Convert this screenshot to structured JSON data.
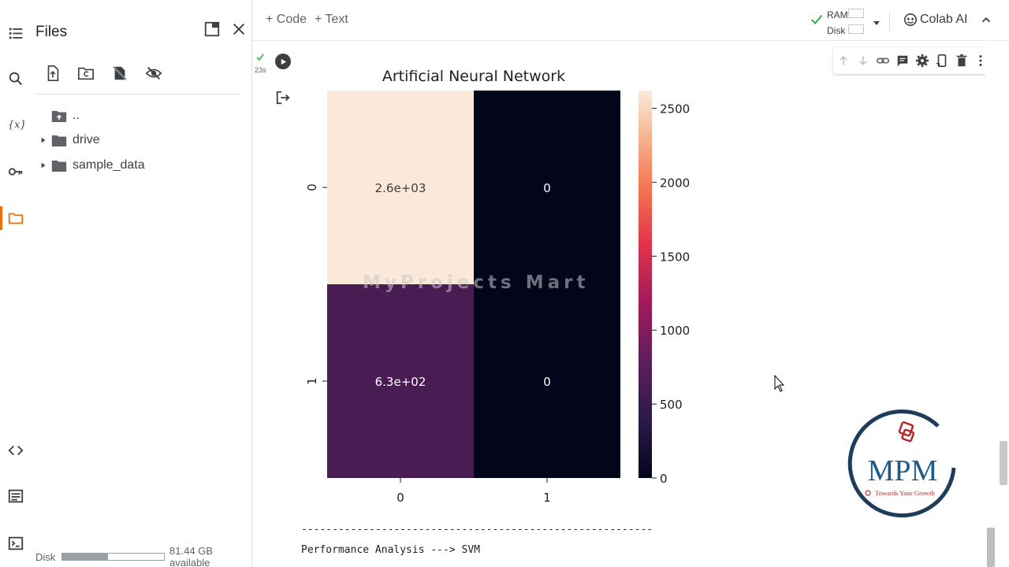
{
  "files_panel": {
    "title": "Files",
    "tree": [
      {
        "label": ".."
      },
      {
        "label": "drive"
      },
      {
        "label": "sample_data"
      }
    ],
    "disk": {
      "label": "Disk",
      "available": "81.44 GB available",
      "used_fraction": 0.45
    }
  },
  "toolbar": {
    "add_code": "+ Code",
    "add_text": "+ Text",
    "ram_label": "RAM",
    "disk_label": "Disk",
    "colab_ai": "Colab AI"
  },
  "cell": {
    "exec_time": "23s"
  },
  "chart_data": {
    "type": "heatmap",
    "title": "Artificial Neural Network",
    "x_categories": [
      "0",
      "1"
    ],
    "y_categories": [
      "0",
      "1"
    ],
    "values": [
      [
        2600,
        0
      ],
      [
        630,
        0
      ]
    ],
    "annotations": [
      [
        "2.6e+03",
        "0"
      ],
      [
        "6.3e+02",
        "0"
      ]
    ],
    "colorbar": {
      "min": 0,
      "max": 2620,
      "ticks": [
        0,
        500,
        1000,
        1500,
        2000,
        2500
      ],
      "colormap": "rocket"
    }
  },
  "output": {
    "dash_line": "---------------------------------------------------------",
    "performance_line": "Performance Analysis ---> SVM"
  },
  "watermark": "MyProjects Mart",
  "logo": {
    "text": "MPM",
    "tagline": "Towards Your Growth",
    "ring_color": "#1f3d5a",
    "text_color": "#1d5a8c"
  },
  "colors": {
    "accent": "#e8710a",
    "check": "#34a853"
  }
}
